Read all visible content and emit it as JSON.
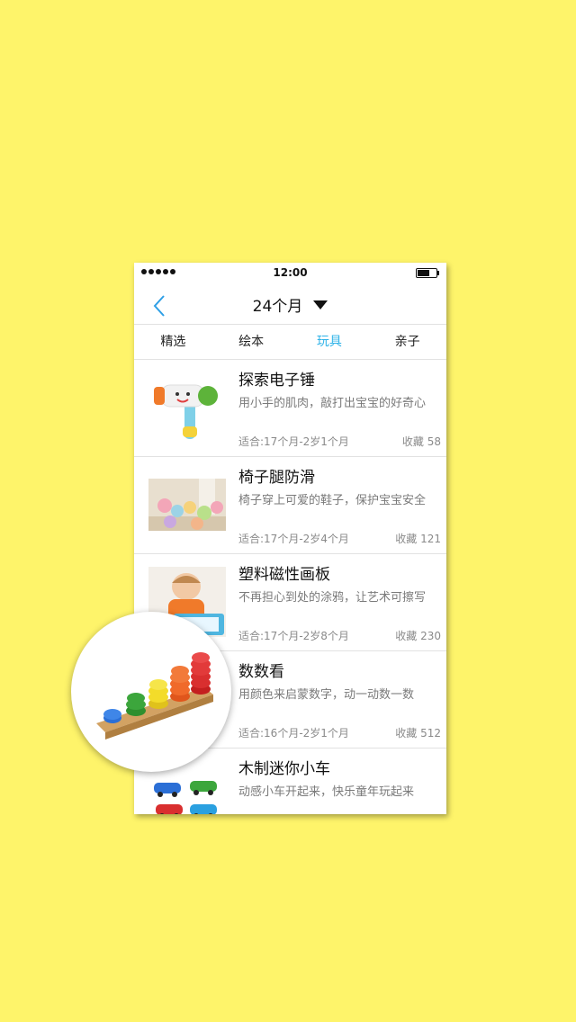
{
  "status": {
    "time": "12:00"
  },
  "nav": {
    "back_glyph": "〈",
    "title": "24个月"
  },
  "tabs": [
    {
      "label": "精选"
    },
    {
      "label": "绘本"
    },
    {
      "label": "玩具",
      "active": true
    },
    {
      "label": "亲子"
    }
  ],
  "items": [
    {
      "title": "探索电子锤",
      "desc": "用小手的肌肉，敲打出宝宝的好奇心",
      "age": "适合:17个月-2岁1个月",
      "fav": "收藏  58",
      "thumb": "toy-hammer"
    },
    {
      "title": "椅子腿防滑",
      "desc": "椅子穿上可爱的鞋子，保护宝宝安全",
      "age": "适合:17个月-2岁4个月",
      "fav": "收藏  121",
      "thumb": "chair-leg-socks"
    },
    {
      "title": "塑料磁性画板",
      "desc": "不再担心到处的涂鸦，让艺术可擦写",
      "age": "适合:17个月-2岁8个月",
      "fav": "收藏  230",
      "thumb": "child-drawing-board"
    },
    {
      "title": "数数看",
      "desc": "用颜色来启蒙数字，动一动数一数",
      "age": "适合:16个月-2岁1个月",
      "fav": "收藏  512",
      "thumb": "stacking-rings"
    },
    {
      "title": "木制迷你小车",
      "desc": "动感小车开起来，快乐童年玩起来",
      "age": "",
      "fav": "",
      "thumb": "mini-cars"
    }
  ],
  "colors": {
    "background": "#fef46a",
    "accent": "#2fb3e8"
  }
}
